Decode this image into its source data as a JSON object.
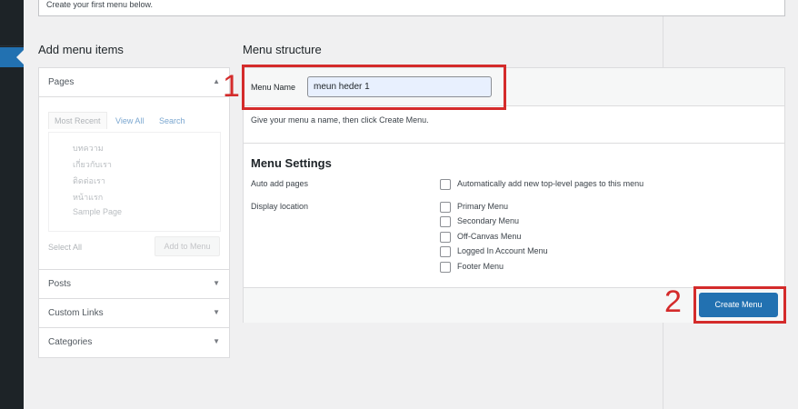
{
  "top_notice": "Create your first menu below.",
  "add_menu_items": {
    "title": "Add menu items",
    "pages": {
      "label": "Pages",
      "arrow": "▲",
      "tabs": [
        "Most Recent",
        "View All",
        "Search"
      ],
      "items": [
        "บทความ",
        "เกี่ยวกับเรา",
        "ติดต่อเรา",
        "หน้าแรก",
        "Sample Page"
      ],
      "select_all": "Select All",
      "add_button": "Add to Menu"
    },
    "sections": [
      {
        "label": "Posts",
        "arrow": "▼"
      },
      {
        "label": "Custom Links",
        "arrow": "▼"
      },
      {
        "label": "Categories",
        "arrow": "▼"
      }
    ]
  },
  "menu_structure": {
    "title": "Menu structure",
    "name_label": "Menu Name",
    "name_value": "meun heder 1",
    "hint": "Give your menu a name, then click Create Menu.",
    "settings_title": "Menu Settings",
    "auto_add_label": "Auto add pages",
    "auto_add_option": "Automatically add new top-level pages to this menu",
    "display_location_label": "Display location",
    "locations": [
      "Primary Menu",
      "Secondary Menu",
      "Off-Canvas Menu",
      "Logged In Account Menu",
      "Footer Menu"
    ],
    "create_button": "Create Menu"
  },
  "annotations": {
    "step1": "1",
    "step2": "2",
    "color": "#d42b2b"
  },
  "colors": {
    "primary": "#2271b1",
    "admin_bar": "#1d2327",
    "background": "#f0f0f1"
  }
}
